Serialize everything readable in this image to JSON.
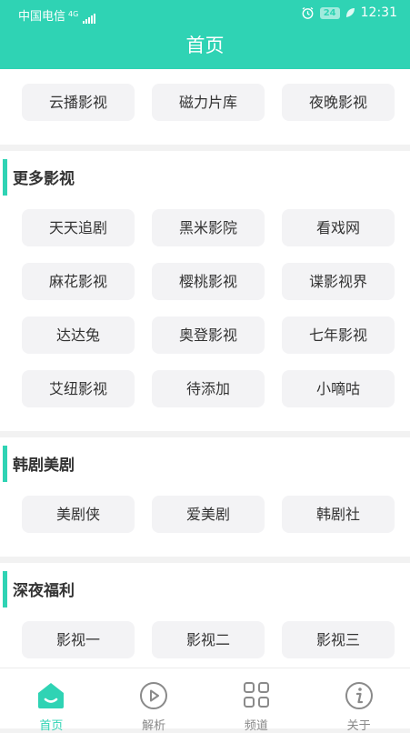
{
  "status_bar": {
    "carrier": "中国电信",
    "network": "4G",
    "battery": "24",
    "time": "12:31"
  },
  "header": {
    "title": "首页"
  },
  "top_section": {
    "items": [
      "云播影视",
      "磁力片库",
      "夜晚影视"
    ]
  },
  "sections": [
    {
      "title": "更多影视",
      "items": [
        "天天追剧",
        "黑米影院",
        "看戏网",
        "麻花影视",
        "樱桃影视",
        "谍影视界",
        "达达兔",
        "奥登影视",
        "七年影视",
        "艾纽影视",
        "待添加",
        "小嘀咕"
      ]
    },
    {
      "title": "韩剧美剧",
      "items": [
        "美剧侠",
        "爱美剧",
        "韩剧社"
      ]
    },
    {
      "title": "深夜福利",
      "items": [
        "影视一",
        "影视二",
        "影视三"
      ]
    }
  ],
  "bottom_nav": {
    "items": [
      {
        "label": "首页",
        "icon": "home-icon",
        "active": true
      },
      {
        "label": "解析",
        "icon": "play-circle-icon",
        "active": false
      },
      {
        "label": "频道",
        "icon": "grid-icon",
        "active": false
      },
      {
        "label": "关于",
        "icon": "info-icon",
        "active": false
      }
    ]
  },
  "colors": {
    "accent": "#2fd3b4",
    "chip_bg": "#f3f3f5",
    "page_bg": "#f2f2f2",
    "inactive": "#888888"
  }
}
